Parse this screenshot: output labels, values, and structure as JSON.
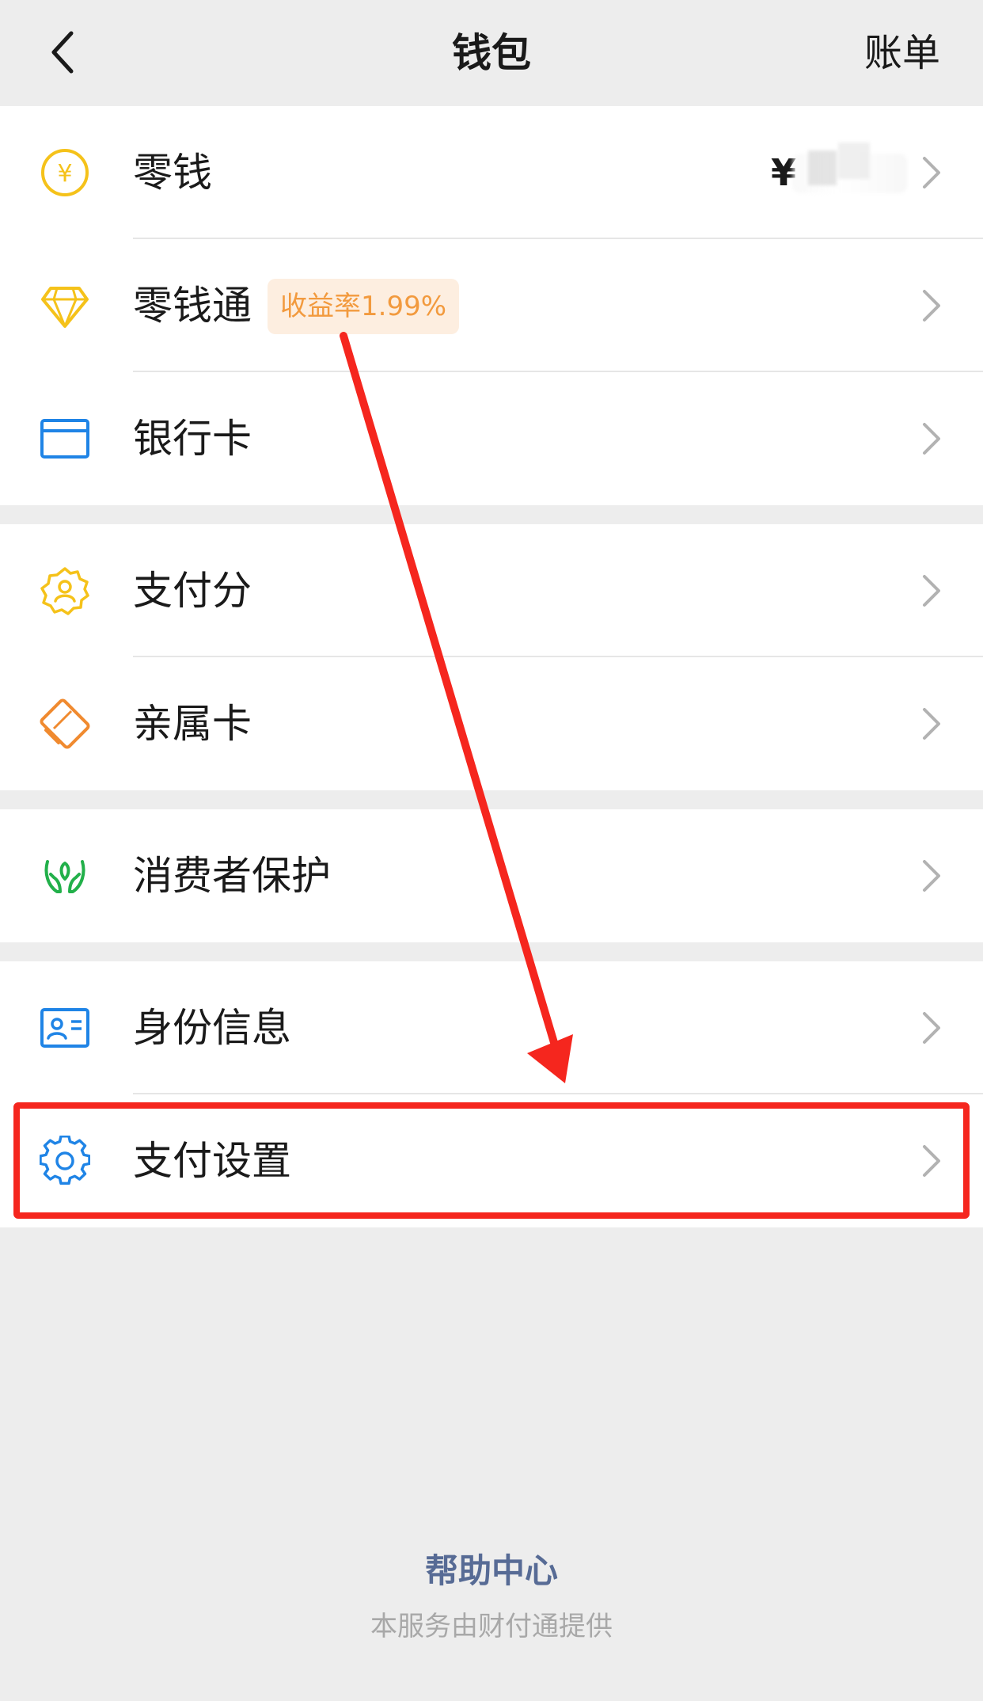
{
  "nav": {
    "back_icon": "chevron-left-icon",
    "title": "钱包",
    "right_label": "账单"
  },
  "groups": [
    {
      "items": [
        {
          "label": "零钱",
          "icon": "yuan-coin-icon",
          "amount_prefix": "¥",
          "icon_color": "#f5c21a"
        },
        {
          "label": "零钱通",
          "icon": "diamond-icon",
          "badge": "收益率1.99%",
          "icon_color": "#f5c21a"
        },
        {
          "label": "银行卡",
          "icon": "bank-card-icon",
          "icon_color": "#1f84e6"
        }
      ]
    },
    {
      "items": [
        {
          "label": "支付分",
          "icon": "score-badge-icon",
          "icon_color": "#f5c21a"
        },
        {
          "label": "亲属卡",
          "icon": "family-card-icon",
          "icon_color": "#f08a2f"
        }
      ]
    },
    {
      "items": [
        {
          "label": "消费者保护",
          "icon": "protect-hands-icon",
          "icon_color": "#22b04a"
        }
      ]
    },
    {
      "items": [
        {
          "label": "身份信息",
          "icon": "id-card-icon",
          "icon_color": "#1f84e6"
        },
        {
          "label": "支付设置",
          "icon": "gear-icon",
          "icon_color": "#1f84e6"
        }
      ]
    }
  ],
  "footer": {
    "help_link": "帮助中心",
    "note": "本服务由财付通提供"
  },
  "annotation": {
    "color": "#f5261e"
  }
}
